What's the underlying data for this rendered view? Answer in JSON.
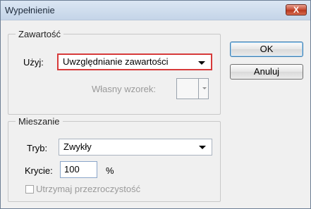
{
  "window": {
    "title": "Wypełnienie",
    "close_label": "X"
  },
  "content": {
    "legend": "Zawartość",
    "use_label": "Użyj:",
    "use_value": "Uwzględnianie zawartości",
    "pattern_label": "Własny wzorek:"
  },
  "blending": {
    "legend": "Mieszanie",
    "mode_label": "Tryb:",
    "mode_value": "Zwykły",
    "opacity_label": "Krycie:",
    "opacity_value": "100",
    "opacity_unit": "%",
    "preserve_label": "Utrzymaj przezroczystość"
  },
  "buttons": {
    "ok": "OK",
    "cancel": "Anuluj"
  }
}
